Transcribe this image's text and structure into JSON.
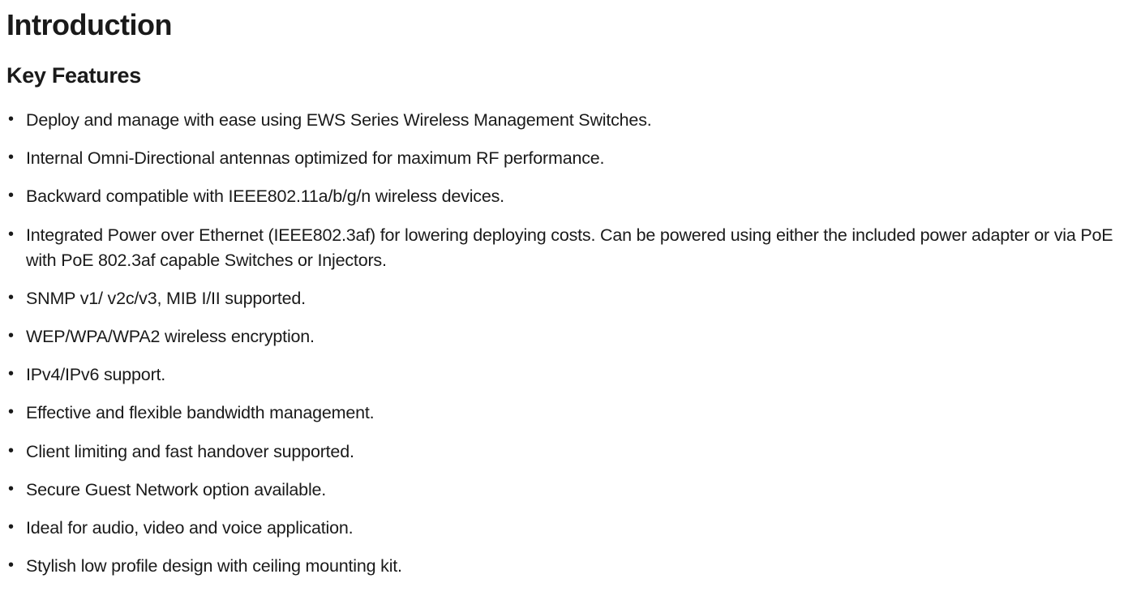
{
  "heading": "Introduction",
  "subheading": "Key Features",
  "features": [
    "Deploy and manage with ease using EWS Series Wireless Management Switches.",
    "Internal Omni-Directional antennas optimized for maximum RF performance.",
    "Backward compatible with IEEE802.11a/b/g/n wireless devices.",
    "Integrated Power over Ethernet (IEEE802.3af) for lowering deploying costs. Can be powered using either the included power adapter or via PoE with PoE 802.3af capable Switches or Injectors.",
    "SNMP v1/ v2c/v3, MIB I/II supported.",
    "WEP/WPA/WPA2 wireless encryption.",
    "IPv4/IPv6 support.",
    "Effective and flexible bandwidth management.",
    "Client limiting and fast handover supported.",
    "Secure Guest Network option available.",
    "Ideal for audio, video and voice application.",
    "Stylish low profile design with ceiling mounting kit."
  ]
}
